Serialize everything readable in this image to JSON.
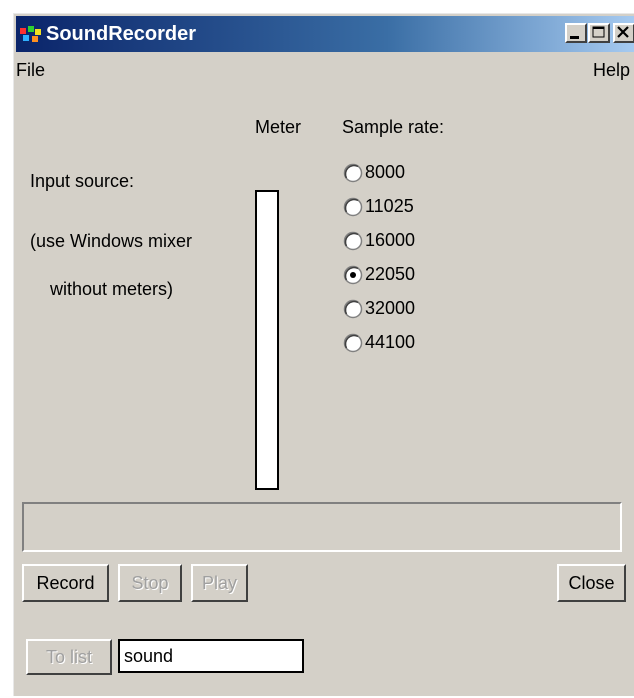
{
  "window": {
    "title": "SoundRecorder",
    "controls": {
      "minimize_icon": "minimize-icon",
      "maximize_icon": "maximize-icon",
      "close_icon": "close-icon"
    }
  },
  "menu": {
    "file": "File",
    "help": "Help"
  },
  "input_source": {
    "label": "Input source:",
    "note_line1": "(use Windows mixer",
    "note_line2": "without meters)"
  },
  "meter": {
    "label": "Meter",
    "level": 0
  },
  "sample_rate": {
    "label": "Sample rate:",
    "options": [
      "8000",
      "11025",
      "16000",
      "22050",
      "32000",
      "44100"
    ],
    "selected": "22050"
  },
  "status_text": "",
  "buttons": {
    "record": "Record",
    "stop": "Stop",
    "play": "Play",
    "close": "Close",
    "to_list": "To list"
  },
  "filename": {
    "value": "sound"
  },
  "colors": {
    "titlebar_start": "#0a246a",
    "titlebar_end": "#a6caf0",
    "face": "#d4d0c8"
  }
}
